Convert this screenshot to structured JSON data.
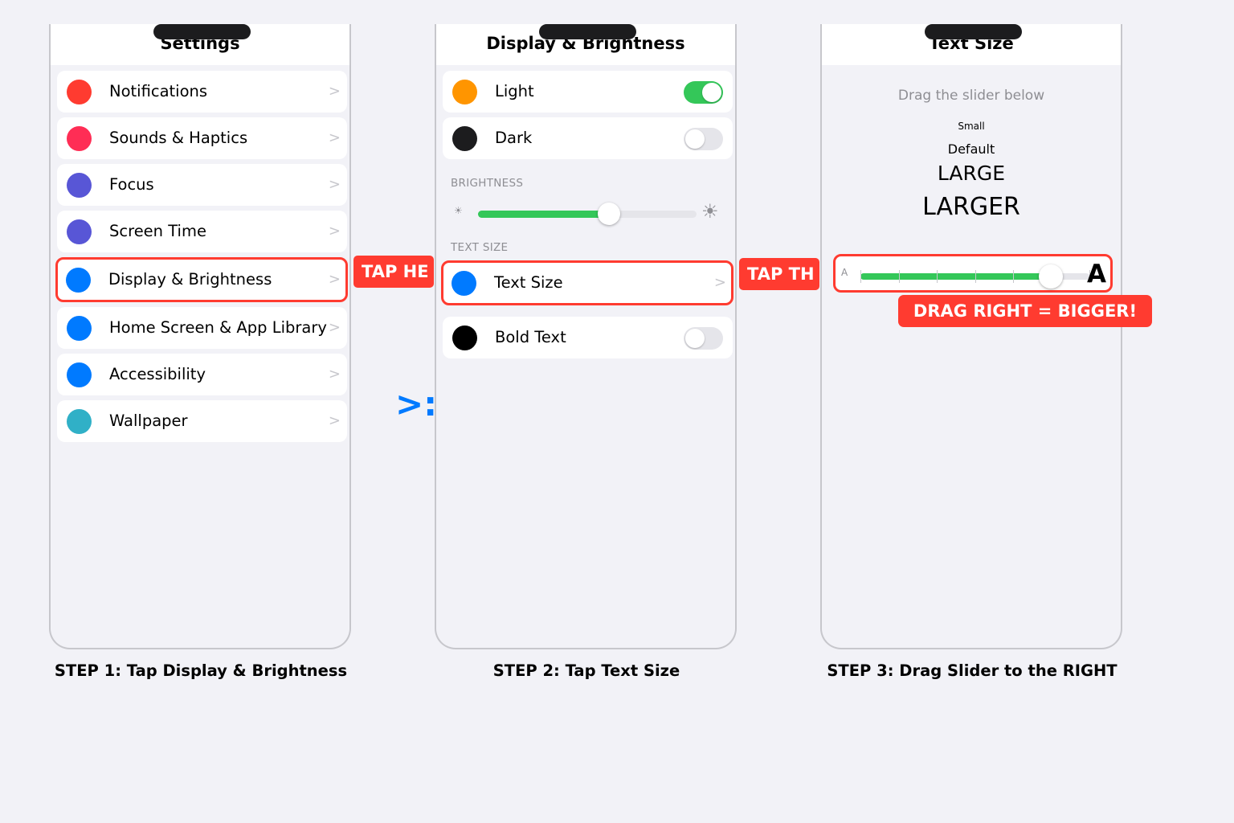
{
  "step1": {
    "title": "Settings",
    "items": [
      {
        "label": "Notifications",
        "color": "#ff3b30",
        "chevron": ">"
      },
      {
        "label": "Sounds & Haptics",
        "color": "#ff2d55",
        "chevron": ">"
      },
      {
        "label": "Focus",
        "color": "#5856d6",
        "chevron": ">"
      },
      {
        "label": "Screen Time",
        "color": "#5856d6",
        "chevron": ">"
      },
      {
        "label": "Display & Brightness",
        "color": "#007aff",
        "chevron": ">"
      },
      {
        "label": "Home Screen & App Library",
        "color": "#007aff",
        "chevron": ">"
      },
      {
        "label": "Accessibility",
        "color": "#007aff",
        "chevron": ">"
      },
      {
        "label": "Wallpaper",
        "color": "#30b0c7",
        "chevron": ">"
      }
    ],
    "callout": "TAP HE",
    "caption": "STEP 1: Tap Display & Brightness"
  },
  "arrow": ">:",
  "step2": {
    "title": "Display & Brightness",
    "light_label": "Light",
    "light_color": "#ff9500",
    "light_on": true,
    "dark_label": "Dark",
    "dark_color": "#1c1c1e",
    "dark_on": false,
    "brightness_header": "BRIGHTNESS",
    "brightness_level": 0.6,
    "textsize_header": "TEXT SIZE",
    "textsize_label": "Text Size",
    "textsize_color": "#007aff",
    "textsize_chevron": ">",
    "bold_label": "Bold Text",
    "bold_color": "#000000",
    "bold_on": false,
    "callout": "TAP TH",
    "caption": "STEP 2: Tap Text Size"
  },
  "step3": {
    "title": "Text Size",
    "instruction": "Drag the slider below",
    "size_small": "Small",
    "size_default": "Default",
    "size_large": "LARGE",
    "size_larger": "LARGER",
    "slider_small_a": "A",
    "slider_big_a": "A",
    "slider_level": 0.83,
    "callout": "DRAG RIGHT = BIGGER!",
    "caption": "STEP 3: Drag Slider to the RIGHT"
  },
  "colors": {
    "accent_red": "#ff3b30",
    "toggle_on": "#34c759",
    "arrow_blue": "#007aff"
  }
}
